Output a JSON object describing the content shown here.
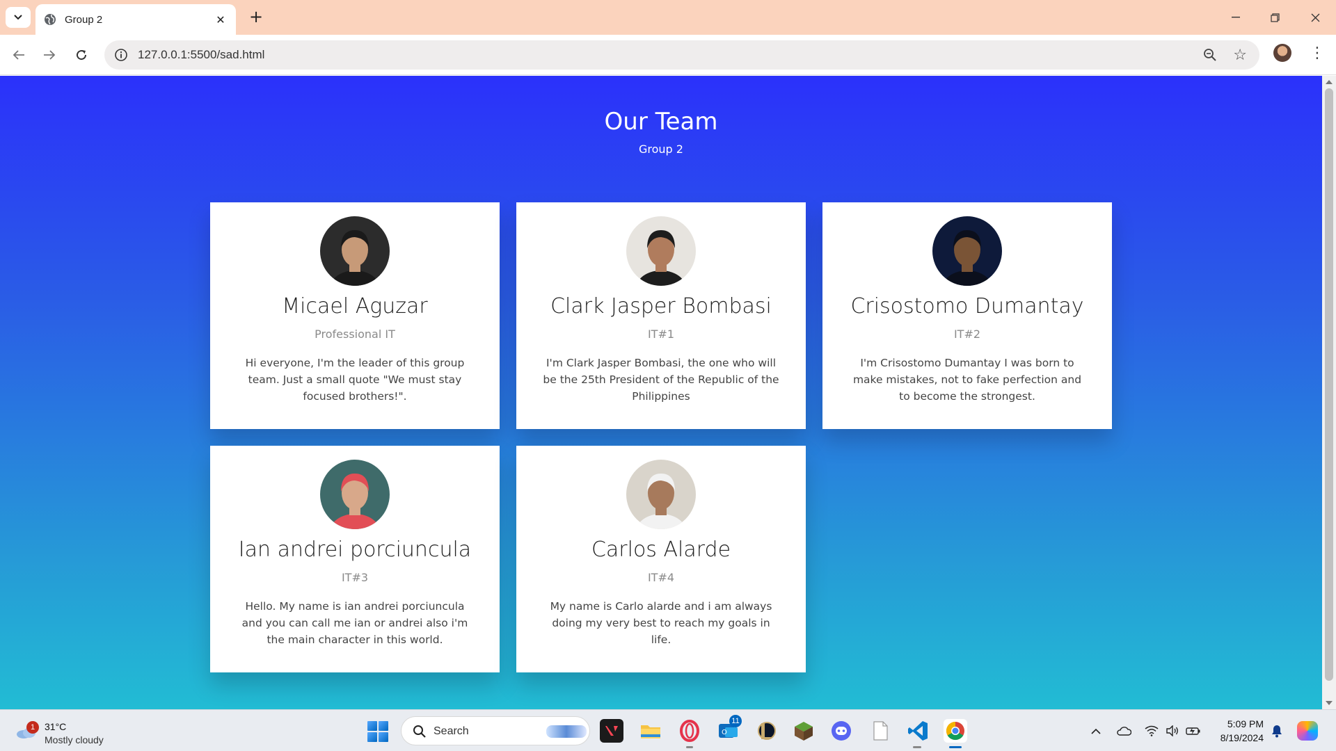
{
  "browser": {
    "tab_title": "Group 2",
    "url": "127.0.0.1:5500/sad.html",
    "new_tab_symbol": "+",
    "tab_close_symbol": "✕"
  },
  "page": {
    "title": "Our Team",
    "subtitle": "Group 2",
    "gradient_colors": [
      "#2b31fb",
      "#2a5ce6",
      "#2698d7",
      "#22bcd4"
    ]
  },
  "members": [
    {
      "name": "Micael Aguzar",
      "role": "Professional IT",
      "bio": "Hi everyone, I'm the leader of this group team. Just a small quote \"We must stay focused brothers!\".",
      "avatar_colors": [
        "#2c2c2c",
        "#c79a78",
        "#1a1a1a"
      ]
    },
    {
      "name": "Clark Jasper Bombasi",
      "role": "IT#1",
      "bio": "I'm Clark Jasper Bombasi, the one who will be the 25th President of the Republic of the Philippines",
      "avatar_colors": [
        "#e7e4df",
        "#b07c5d",
        "#1d1d1d"
      ]
    },
    {
      "name": "Crisostomo Dumantay",
      "role": "IT#2",
      "bio": "I'm Crisostomo Dumantay I was born to make mistakes, not to fake perfection and to become the strongest.",
      "avatar_colors": [
        "#0e1a3a",
        "#7a5436",
        "#0b0f1c"
      ]
    },
    {
      "name": "Ian andrei porciuncula",
      "role": "IT#3",
      "bio": "Hello. My name is ian andrei porciuncula and you can call me ian or andrei also i'm the main character in this world.",
      "avatar_colors": [
        "#3f6b6a",
        "#d8a88a",
        "#e24e56"
      ]
    },
    {
      "name": "Carlos Alarde",
      "role": "IT#4",
      "bio": "My name is Carlo alarde and i am always doing my very best to reach my goals in life.",
      "avatar_colors": [
        "#d9d4cb",
        "#a77a5c",
        "#f2f2f2"
      ]
    }
  ],
  "taskbar": {
    "weather_temp": "31°C",
    "weather_condition": "Mostly cloudy",
    "weather_badge": "1",
    "search_label": "Search",
    "time": "5:09 PM",
    "date": "8/19/2024",
    "mail_badge": "11"
  }
}
